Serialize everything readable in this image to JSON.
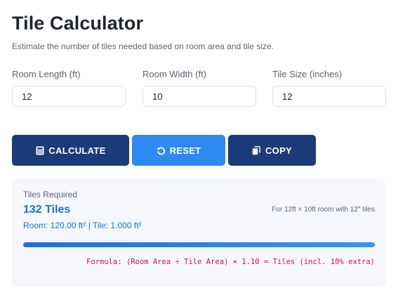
{
  "header": {
    "title": "Tile Calculator",
    "subtitle": "Estimate the number of tiles needed based on room area and tile size."
  },
  "inputs": {
    "length": {
      "label": "Room Length (ft)",
      "value": "12"
    },
    "width": {
      "label": "Room Width (ft)",
      "value": "10"
    },
    "tile_size": {
      "label": "Tile Size (inches)",
      "value": "12"
    }
  },
  "buttons": {
    "calculate": {
      "label": "CALCULATE",
      "icon": "calculator-icon"
    },
    "reset": {
      "label": "RESET",
      "icon": "reset-icon"
    },
    "copy": {
      "label": "COPY",
      "icon": "copy-icon"
    }
  },
  "result": {
    "label": "Tiles Required",
    "value": "132 Tiles",
    "context": "For 12ft × 10ft room with 12\" tiles",
    "detail": "Room: 120.00 ft² | Tile: 1.000 ft²",
    "progress_fraction": 1.0,
    "formula": "Formula: (Room Area ÷ Tile Area) × 1.10 = Tiles (incl. 10% extra)"
  },
  "colors": {
    "primary_dark": "#1c3a78",
    "primary_light": "#2e8af0",
    "accent_blue": "#1f6ed6",
    "formula_magenta": "#c2185b",
    "panel_bg": "#f5f7fc"
  }
}
